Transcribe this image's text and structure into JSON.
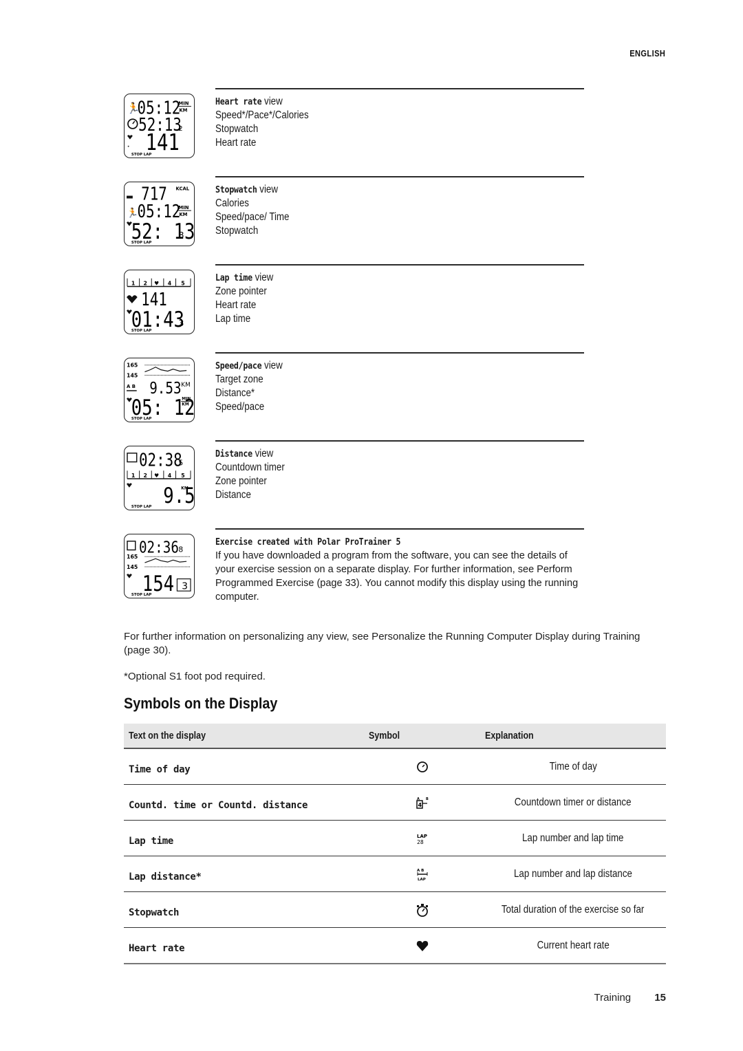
{
  "header": {
    "language": "ENGLISH"
  },
  "views": [
    {
      "title_bold": "Heart rate",
      "title_suffix": "view",
      "lines": [
        "Speed*/Pace*/Calories",
        "Stopwatch",
        "Heart rate"
      ],
      "display": {
        "row1": "05:12",
        "row1_unit_top": "MIN",
        "row1_unit_bottom": "KM",
        "row2": "52:13",
        "row2_small": "2",
        "row3": "141",
        "footer": "STOP LAP"
      }
    },
    {
      "title_bold": "Stopwatch",
      "title_suffix": "view",
      "lines": [
        "Calories",
        "Speed/pace/ Time",
        "Stopwatch"
      ],
      "display": {
        "row1": "717",
        "row1_unit": "KCAL",
        "row2": "05:12",
        "row2_unit_top": "MIN",
        "row2_unit_bottom": "KM",
        "row3": "52: 13",
        "row3_small": "8",
        "footer": "STOP LAP"
      }
    },
    {
      "title_bold": "Lap time",
      "title_suffix": "view",
      "lines": [
        "Zone pointer",
        "Heart rate",
        "Lap time"
      ],
      "display": {
        "zones": [
          "1",
          "2",
          "♥",
          "4",
          "5"
        ],
        "row2": "141",
        "row3": "01:43",
        "row3_small": "3",
        "footer": "STOP LAP"
      }
    },
    {
      "title_bold": "Speed/pace",
      "title_suffix": "view",
      "lines": [
        "Target zone",
        "Distance*",
        "Speed/pace"
      ],
      "display": {
        "zone_high": "165",
        "zone_low": "145",
        "row2": "9.53",
        "row2_unit": "KM",
        "row3": "05: 12",
        "row3_unit_top": "MIN",
        "row3_unit_bottom": "KM",
        "footer": "STOP LAP"
      }
    },
    {
      "title_bold": "Distance",
      "title_suffix": "view",
      "lines": [
        "Countdown timer",
        "Zone pointer",
        "Distance"
      ],
      "display": {
        "row1": "02:38",
        "row1_small": "5",
        "zones": [
          "1",
          "2",
          "♥",
          "4",
          "5"
        ],
        "row3": "9.53",
        "row3_unit": "KM",
        "footer": "STOP LAP"
      }
    },
    {
      "title_bold": "Exercise created with Polar ProTrainer 5",
      "title_suffix": "",
      "paragraph": "If you have downloaded a program from the software, you can see the details of your exercise session on a separate display. For further information, see Perform Programmed Exercise (page 33). You cannot modify this display using the running computer.",
      "display": {
        "row1": "02:36",
        "row1_small": "8",
        "zone_high": "165",
        "zone_low": "145",
        "row3": "154",
        "phase": "3",
        "footer": "STOP LAP"
      }
    }
  ],
  "body": {
    "personalize_note": "For further information on personalizing any view, see Personalize the Running Computer Display during Training (page 30).",
    "footnote": "*Optional S1 foot pod required."
  },
  "symbols_section": {
    "title": "Symbols on the Display",
    "columns": [
      "Text on the display",
      "Symbol",
      "Explanation"
    ],
    "rows": [
      {
        "text": "Time of day",
        "symbol": "clock-icon",
        "explanation": "Time of day"
      },
      {
        "text": "Countd. time or Countd. distance",
        "symbol": "countdown-icon",
        "explanation": "Countdown timer or distance"
      },
      {
        "text": "Lap time",
        "symbol": "lap-time-icon",
        "explanation": "Lap number and lap time"
      },
      {
        "text": "Lap distance*",
        "symbol": "lap-distance-icon",
        "explanation": "Lap number and lap distance"
      },
      {
        "text": "Stopwatch",
        "symbol": "stopwatch-icon",
        "explanation": "Total duration of the exercise so far"
      },
      {
        "text": "Heart rate",
        "symbol": "heart-icon",
        "explanation": "Current heart rate"
      }
    ]
  },
  "footer": {
    "section": "Training",
    "page": "15"
  }
}
